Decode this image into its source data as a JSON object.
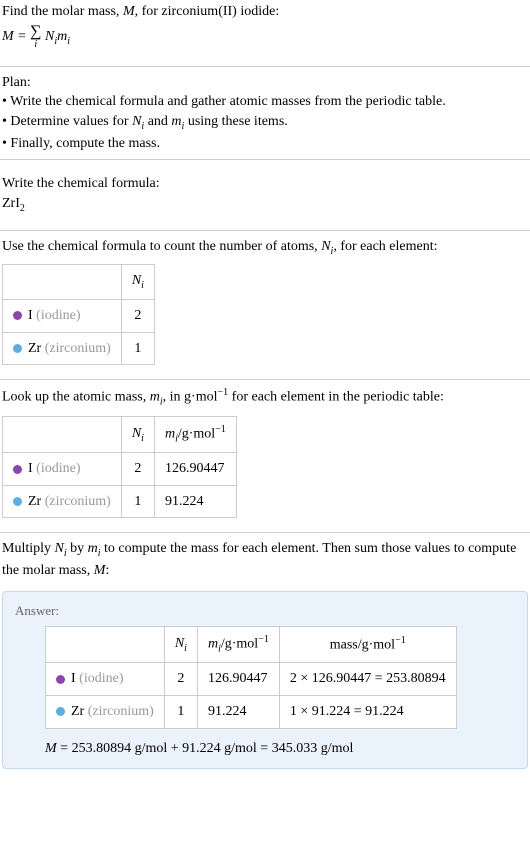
{
  "intro": {
    "line1": "Find the molar mass, ",
    "var_M": "M",
    "line1b": ", for zirconium(II) iodide:",
    "eq_lhs": "M = ",
    "eq_rhs": " N",
    "eq_rhs2": "m"
  },
  "plan": {
    "heading": "Plan:",
    "b1": "• Write the chemical formula and gather atomic masses from the periodic table.",
    "b2_a": "• Determine values for ",
    "b2_b": " and ",
    "b2_c": " using these items.",
    "b3": "• Finally, compute the mass."
  },
  "formula": {
    "heading": "Write the chemical formula:",
    "symbol": "ZrI",
    "sub": "2"
  },
  "count": {
    "heading_a": "Use the chemical formula to count the number of atoms, ",
    "heading_b": ", for each element:",
    "col_Ni": "N",
    "row1_el": "I ",
    "row1_name": "(iodine)",
    "row1_n": "2",
    "row2_el": "Zr ",
    "row2_name": "(zirconium)",
    "row2_n": "1"
  },
  "lookup": {
    "heading_a": "Look up the atomic mass, ",
    "heading_b": ", in g·mol",
    "heading_c": " for each element in the periodic table:",
    "sup_neg1": "−1",
    "col_mi_a": "m",
    "col_mi_b": "/g·mol",
    "row1_m": "126.90447",
    "row2_m": "91.224"
  },
  "multiply": {
    "heading_a": "Multiply ",
    "heading_b": " by ",
    "heading_c": " to compute the mass for each element. Then sum those values to compute the molar mass, ",
    "heading_d": ":"
  },
  "answer": {
    "label": "Answer:",
    "col_mass_a": "mass/g·mol",
    "row1_calc": "2 × 126.90447 = 253.80894",
    "row2_calc": "1 × 91.224 = 91.224",
    "final_a": "M",
    "final_b": " = 253.80894 g/mol + 91.224 g/mol = 345.033 g/mol"
  },
  "common": {
    "i": "i",
    "Ni_N": "N",
    "mi_m": "m"
  }
}
